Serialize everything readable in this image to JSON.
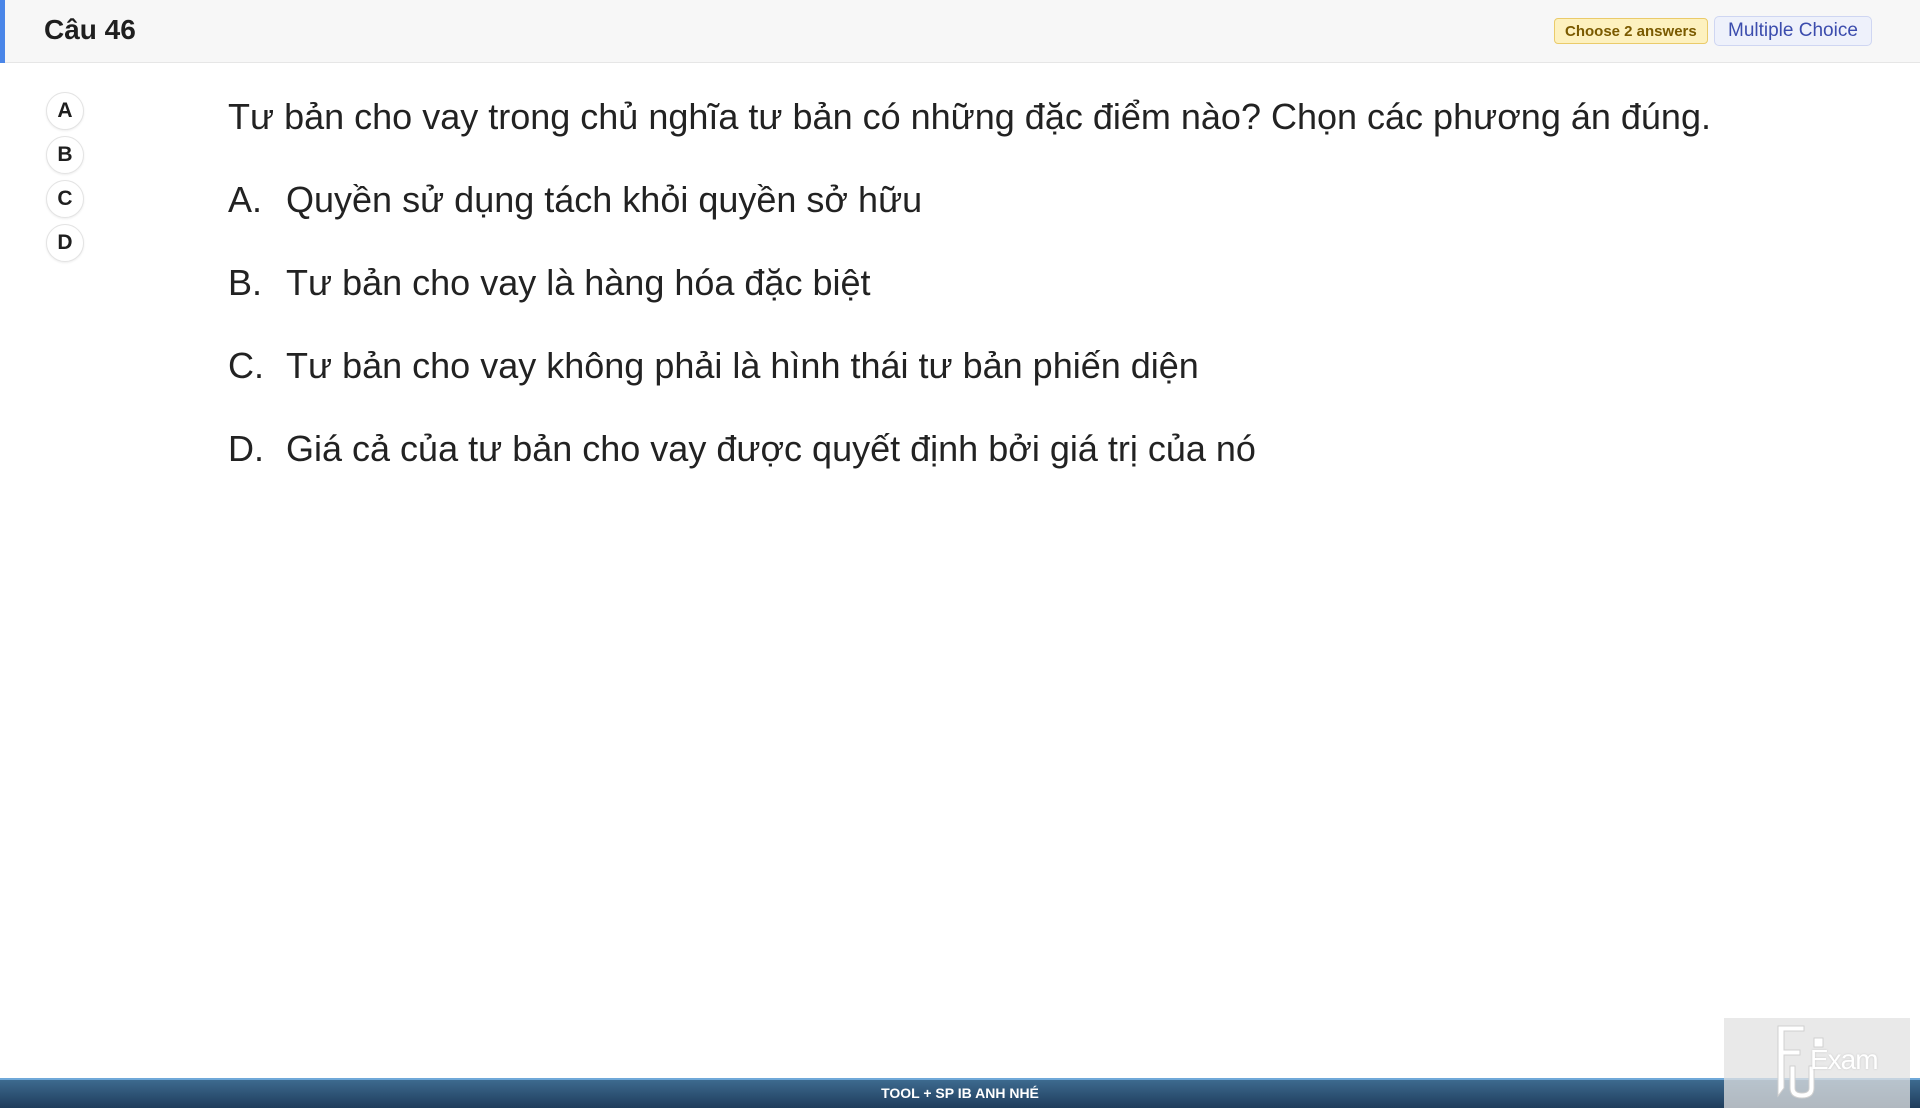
{
  "header": {
    "title": "Câu 46",
    "answers_badge": "Choose 2 answers",
    "type_badge": "Multiple Choice",
    "accent_color": "#4a86e8"
  },
  "answer_buttons": [
    "A",
    "B",
    "C",
    "D"
  ],
  "question": {
    "stem": "Tư bản cho vay trong chủ nghĩa tư bản có những đặc điểm nào? Chọn các phương án đúng.",
    "options": [
      {
        "letter": "A.",
        "text": "Quyền sử dụng tách khỏi quyền sở hữu"
      },
      {
        "letter": "B.",
        "text": "Tư bản cho vay là hàng hóa đặc biệt"
      },
      {
        "letter": "C.",
        "text": "Tư bản cho vay không phải là hình thái tư bản phiến diện"
      },
      {
        "letter": "D.",
        "text": "Giá cả của tư bản cho vay được quyết định bởi giá trị của nó"
      }
    ]
  },
  "footer": {
    "text": "TOOL + SP IB ANH NHÉ"
  },
  "watermark": {
    "logo_text": "Exam",
    "icon": "fu-logo-icon"
  }
}
